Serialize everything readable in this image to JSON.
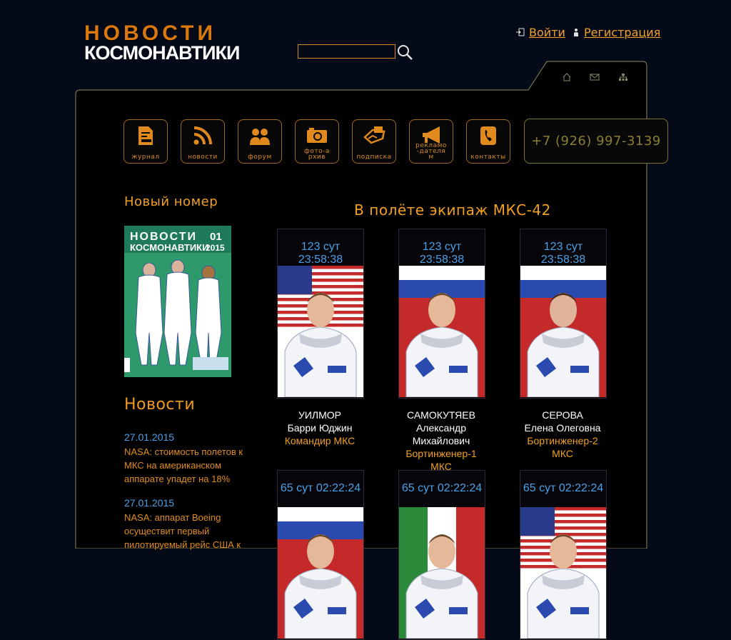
{
  "logo": {
    "line1": "НОВОСТИ",
    "line2": "КОСМОНАВТИКИ"
  },
  "search": {
    "value": "",
    "icon": "search-icon"
  },
  "auth": {
    "login": "Войти",
    "register": "Регистрация"
  },
  "nav": [
    {
      "label": "журнал",
      "icon": "journal-icon"
    },
    {
      "label": "новости",
      "icon": "rss-icon"
    },
    {
      "label": "форум",
      "icon": "forum-icon"
    },
    {
      "label": "фото-архив",
      "icon": "camera-icon"
    },
    {
      "label": "подписка",
      "icon": "subscription-icon"
    },
    {
      "label": "рекламо-дателям",
      "icon": "megaphone-icon"
    },
    {
      "label": "контакты",
      "icon": "phone-icon"
    }
  ],
  "phone": "+7 (926) 997-3139",
  "left": {
    "new_issue_heading": "Новый номер",
    "cover": {
      "title1": "НОВОСТИ",
      "title2": "КОСМОНАВТИКИ",
      "issue": "01",
      "year": "2015"
    },
    "news_heading": "Новости",
    "news": [
      {
        "date": "27.01.2015",
        "text": "NASA: стоимость полетов к МКС на американском аппарате упадет на 18%"
      },
      {
        "date": "27.01.2015",
        "text": "NASA: аппарат Boeing осуществит первый пилотируемый рейс США к"
      }
    ]
  },
  "crew": {
    "title": "В полёте экипаж МКС-42",
    "members": [
      {
        "time": "123 сут 23:58:38",
        "surname": "УИЛМОР",
        "given": "Барри Юджин",
        "role": "Командир МКС",
        "flag": "us"
      },
      {
        "time": "123 сут 23:58:38",
        "surname": "САМОКУТЯЕВ",
        "given": "Александр Михайлович",
        "role": "Бортинженер-1 МКС",
        "flag": "ru"
      },
      {
        "time": "123 сут 23:58:38",
        "surname": "СЕРОВА",
        "given": "Елена Олеговна",
        "role": "Бортинженер-2 МКС",
        "flag": "ru"
      },
      {
        "time": "65 сут 02:22:24",
        "flag": "ru"
      },
      {
        "time": "65 сут 02:22:24",
        "flag": "it"
      },
      {
        "time": "65 сут 02:22:24",
        "flag": "us"
      }
    ]
  },
  "colors": {
    "accent": "#f0a020",
    "link_blue": "#4aa0e6",
    "background": "#050a18",
    "panel": "#000000"
  }
}
